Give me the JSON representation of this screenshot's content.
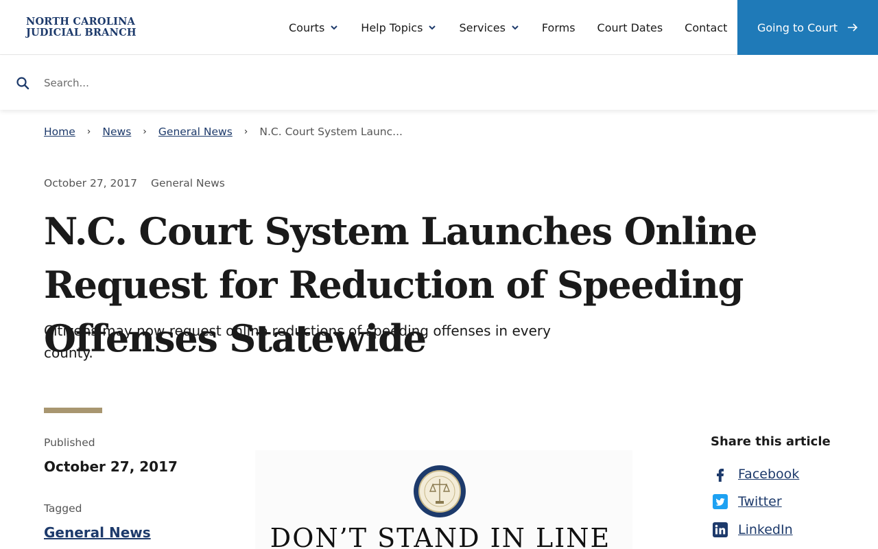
{
  "header": {
    "logo_line1": "NORTH CAROLINA",
    "logo_line2": "JUDICIAL BRANCH",
    "nav": [
      {
        "label": "Courts",
        "dropdown": true
      },
      {
        "label": "Help Topics",
        "dropdown": true
      },
      {
        "label": "Services",
        "dropdown": true
      },
      {
        "label": "Forms",
        "dropdown": false
      },
      {
        "label": "Court Dates",
        "dropdown": false
      },
      {
        "label": "Contact",
        "dropdown": false
      }
    ],
    "cta_label": "Going to Court"
  },
  "search": {
    "placeholder": "Search..."
  },
  "breadcrumb": {
    "items": [
      "Home",
      "News",
      "General News"
    ],
    "current": "N.C. Court System Launc..."
  },
  "article": {
    "date": "October 27, 2017",
    "category": "General News",
    "title": "N.C. Court System Launches Online Request for Reduction of Speeding Offenses Statewide",
    "lede": "Citizens may now request online reductions of speeding offenses in every county.",
    "published_label": "Published",
    "published_date": "October 27, 2017",
    "tagged_label": "Tagged",
    "tag": "General News",
    "image_text": "DON’T STAND IN LINE"
  },
  "share": {
    "title": "Share this article",
    "items": [
      "Facebook",
      "Twitter",
      "LinkedIn"
    ]
  },
  "colors": {
    "brand_navy": "#1d3a6b",
    "cta_blue": "#1f7ab8",
    "accent_gold": "#a89670"
  }
}
